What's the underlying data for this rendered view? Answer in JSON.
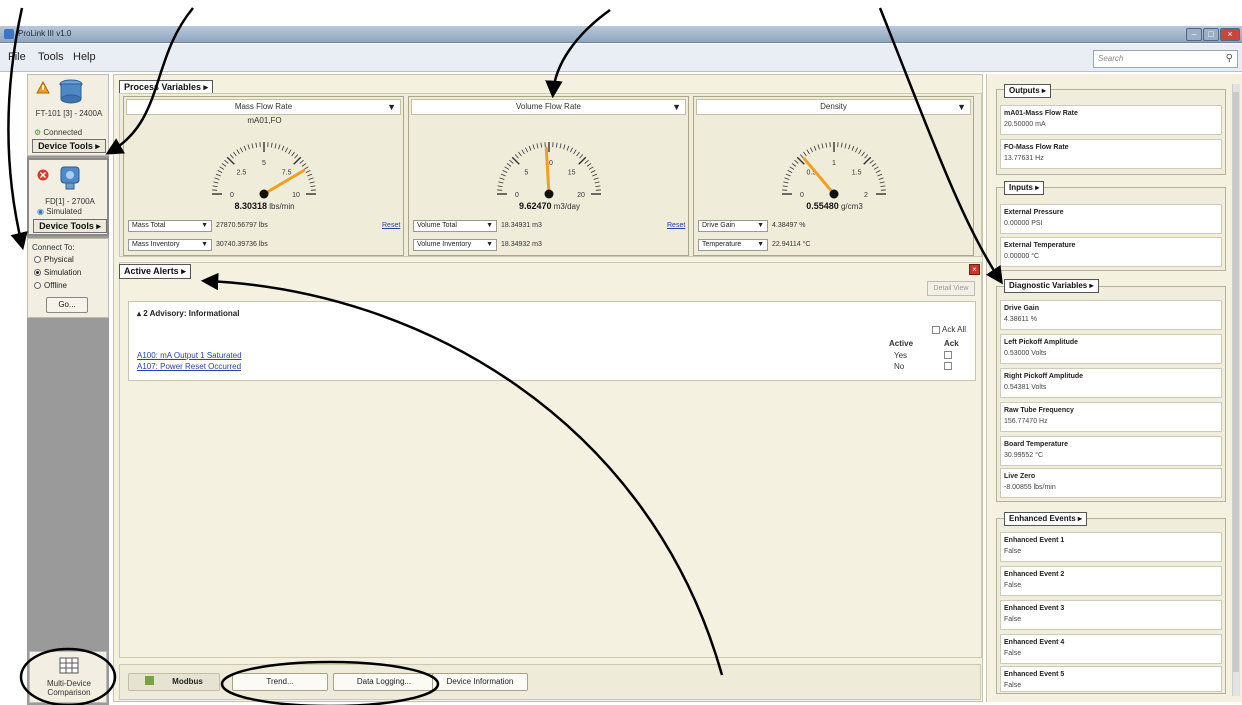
{
  "window": {
    "title": "ProLink III v1.0"
  },
  "menu": {
    "items": [
      "File",
      "Tools",
      "Help"
    ],
    "search_placeholder": "Search"
  },
  "devices": [
    {
      "name": "FT-101 [3] - 2400A",
      "status": "Connected",
      "tools_label": "Device Tools ▸"
    },
    {
      "name": "FD[1] - 2700A",
      "status": "Simulated",
      "tools_label": "Device Tools ▸"
    }
  ],
  "connect": {
    "label": "Connect To:",
    "options": [
      "Physical",
      "Simulation",
      "Offline"
    ],
    "selected": "Simulation",
    "go_label": "Go..."
  },
  "multi_device": {
    "label": "Multi-Device Comparison"
  },
  "process_variables": {
    "tab_label": "Process Variables ▸",
    "gauges": [
      {
        "title": "Mass Flow Rate",
        "tag": "mA01,FO",
        "value": "8.30318",
        "unit": "lbs/min",
        "scale_min": "0",
        "scale_max": "10",
        "ticks": [
          "0",
          "2.5",
          "5",
          "7.5",
          "10"
        ],
        "reading": 8.30318,
        "max": 10,
        "totals": [
          {
            "label": "Mass Total",
            "value": "27870.56797 lbs"
          },
          {
            "label": "Mass Inventory",
            "value": "30740.39736 lbs"
          }
        ],
        "reset": "Reset"
      },
      {
        "title": "Volume Flow Rate",
        "tag": "",
        "value": "9.62470",
        "unit": "m3/day",
        "scale_min": "0",
        "scale_max": "20",
        "ticks": [
          "0",
          "5",
          "10",
          "15",
          "20"
        ],
        "reading": 9.6247,
        "max": 20,
        "totals": [
          {
            "label": "Volume Total",
            "value": "18.34931 m3"
          },
          {
            "label": "Volume Inventory",
            "value": "18.34932 m3"
          }
        ],
        "reset": "Reset"
      },
      {
        "title": "Density",
        "tag": "",
        "value": "0.55480",
        "unit": "g/cm3",
        "scale_min": "0",
        "scale_max": "2",
        "ticks": [
          "0",
          "0.5",
          "1",
          "1.5",
          "2"
        ],
        "reading": 0.5548,
        "max": 2,
        "totals": [
          {
            "label": "Drive Gain",
            "value": "4.38497 %"
          },
          {
            "label": "Temperature",
            "value": "22.94114 °C"
          }
        ],
        "reset": ""
      }
    ]
  },
  "alerts": {
    "tab_label": "Active Alerts ▸",
    "detail_view": "Detail View",
    "group": "2 Advisory: Informational",
    "ack_all": "Ack All",
    "col_active": "Active",
    "col_ack": "Ack",
    "rows": [
      {
        "text": "A100: mA Output 1 Saturated",
        "active": "Yes"
      },
      {
        "text": "A107: Power Reset Occurred",
        "active": "No"
      }
    ]
  },
  "bottom": {
    "protocol": "Modbus",
    "buttons": [
      "Trend...",
      "Data Logging...",
      "Device Information"
    ]
  },
  "outputs": {
    "label": "Outputs ▸",
    "items": [
      {
        "name": "mA01-Mass Flow Rate",
        "value": "20.50000 mA"
      },
      {
        "name": "FO-Mass Flow Rate",
        "value": "13.77631 Hz"
      }
    ]
  },
  "inputs": {
    "label": "Inputs ▸",
    "items": [
      {
        "name": "External Pressure",
        "value": "0.00000 PSI"
      },
      {
        "name": "External Temperature",
        "value": "0.00000 °C"
      }
    ]
  },
  "diagnostics": {
    "label": "Diagnostic Variables ▸",
    "items": [
      {
        "name": "Drive Gain",
        "value": "4.38611 %"
      },
      {
        "name": "Left Pickoff Amplitude",
        "value": "0.53000 Volts"
      },
      {
        "name": "Right Pickoff Amplitude",
        "value": "0.54381 Volts"
      },
      {
        "name": "Raw Tube Frequency",
        "value": "156.77470 Hz"
      },
      {
        "name": "Board Temperature",
        "value": "30.99552 °C"
      },
      {
        "name": "Live Zero",
        "value": "-8.00855 lbs/min"
      }
    ]
  },
  "events": {
    "label": "Enhanced Events ▸",
    "items": [
      {
        "name": "Enhanced Event 1",
        "value": "False"
      },
      {
        "name": "Enhanced Event 2",
        "value": "False"
      },
      {
        "name": "Enhanced Event 3",
        "value": "False"
      },
      {
        "name": "Enhanced Event 4",
        "value": "False"
      },
      {
        "name": "Enhanced Event 5",
        "value": "False"
      }
    ]
  },
  "colors": {
    "gauge_needle": "#f0a020",
    "link": "#2a3fa8",
    "panel_bg": "#f4f1e1"
  }
}
